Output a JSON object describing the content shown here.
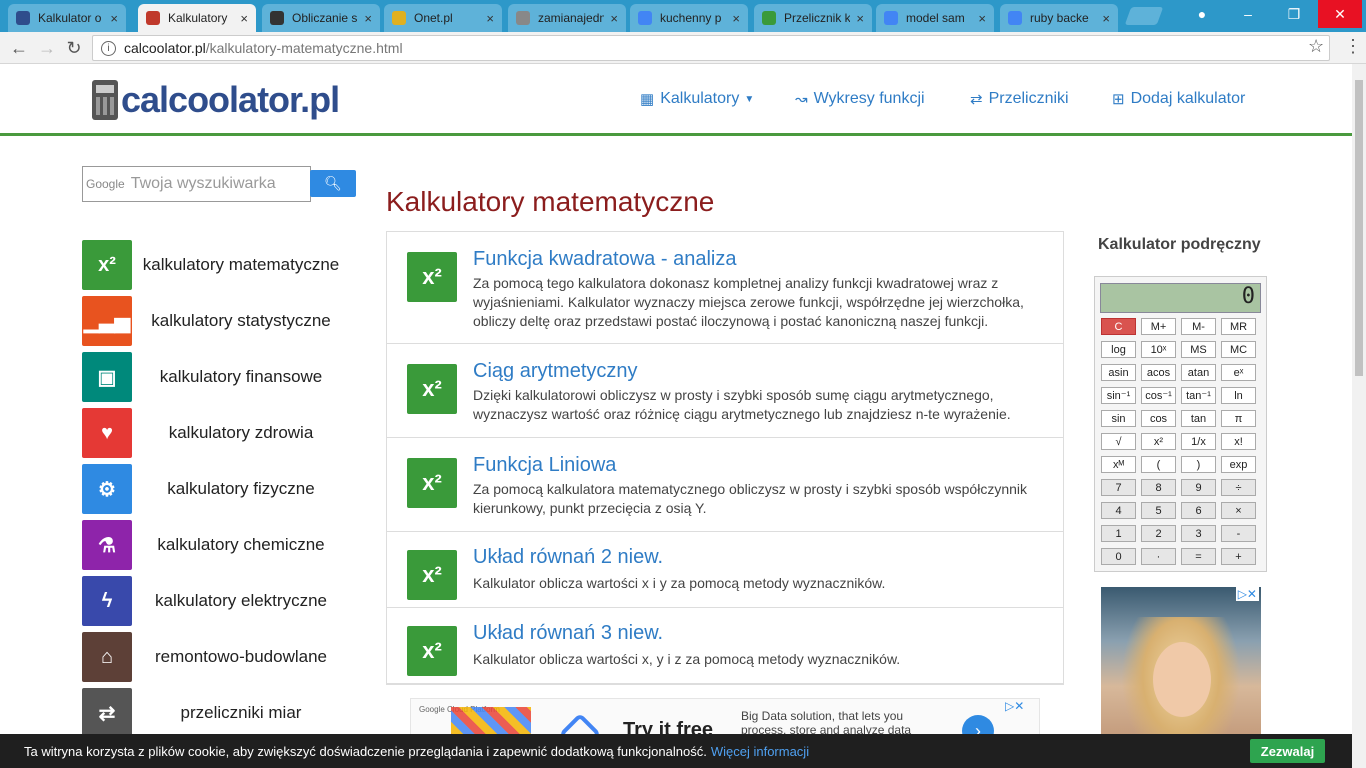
{
  "browser": {
    "tabs": [
      {
        "label": "Kalkulator o",
        "color": "#2f4d8c"
      },
      {
        "label": "Kalkulatory",
        "color": "#c0392b",
        "active": true
      },
      {
        "label": "Obliczanie s",
        "color": "#333"
      },
      {
        "label": "Onet.pl",
        "color": "#e0b020"
      },
      {
        "label": "zamianajedn",
        "color": "#888"
      },
      {
        "label": "kuchenny p",
        "color": "#4285f4"
      },
      {
        "label": "Przelicznik k",
        "color": "#3a9a3a"
      },
      {
        "label": "model sam",
        "color": "#4285f4"
      },
      {
        "label": "ruby backe",
        "color": "#4285f4"
      }
    ],
    "url_host": "calcoolator.pl",
    "url_path": "/kalkulatory-matematyczne.html"
  },
  "header": {
    "logo_text": "calcoolator.pl",
    "nav": {
      "kalkulatory": "Kalkulatory",
      "wykresy": "Wykresy funkcji",
      "przeliczniki": "Przeliczniki",
      "dodaj": "Dodaj kalkulator"
    }
  },
  "search": {
    "google_tag": "Google",
    "placeholder": "Twoja wyszukiwarka"
  },
  "categories": [
    {
      "label": "kalkulatory matematyczne",
      "icon": "x²",
      "color": "#3a9a3a"
    },
    {
      "label": "kalkulatory statystyczne",
      "icon": "bar-chart",
      "color": "#e8531f"
    },
    {
      "label": "kalkulatory finansowe",
      "icon": "money",
      "color": "#00897b"
    },
    {
      "label": "kalkulatory zdrowia",
      "icon": "heartbeat",
      "color": "#e53935"
    },
    {
      "label": "kalkulatory fizyczne",
      "icon": "gears",
      "color": "#2f8ae2"
    },
    {
      "label": "kalkulatory chemiczne",
      "icon": "flask",
      "color": "#8e24aa"
    },
    {
      "label": "kalkulatory elektryczne",
      "icon": "bolt",
      "color": "#3949ab"
    },
    {
      "label": "remontowo-budowlane",
      "icon": "home",
      "color": "#5d4037"
    },
    {
      "label": "przeliczniki miar",
      "icon": "shuffle",
      "color": "#555555"
    }
  ],
  "main": {
    "title": "Kalkulatory matematyczne",
    "items": [
      {
        "title": "Funkcja kwadratowa - analiza",
        "desc": "Za pomocą tego kalkulatora dokonasz kompletnej analizy funkcji kwadratowej wraz z wyjaśnieniami. Kalkulator wyznaczy miejsca zerowe funkcji, współrzędne jej wierzchołka, obliczy deltę oraz przedstawi postać iloczynową i postać kanoniczną naszej funkcji."
      },
      {
        "title": "Ciąg arytmetyczny",
        "desc": "Dzięki kalkulatorowi obliczysz w prosty i szybki sposób sumę ciągu arytmetycznego, wyznaczysz wartość oraz różnicę ciągu arytmetycznego lub znajdziesz n-te wyrażenie."
      },
      {
        "title": "Funkcja Liniowa",
        "desc": "Za pomocą kalkulatora matematycznego obliczysz w prosty i szybki sposób współczynnik kierunkowy, punkt przecięcia z osią Y."
      },
      {
        "title": "Układ równań 2 niew.",
        "desc": "Kalkulator oblicza wartości x i y za pomocą metody wyznaczników."
      },
      {
        "title": "Układ równań 3 niew.",
        "desc": "Kalkulator oblicza wartości x, y i z za pomocą metody wyznaczników."
      }
    ],
    "icon_text": "x²"
  },
  "ad": {
    "cta": "Try it free",
    "text": "Big Data solution, that lets you process, store and analyze data",
    "source": "Google Cloud Platform"
  },
  "calculator": {
    "title": "Kalkulator podręczny",
    "display": "0",
    "keys": [
      [
        "C",
        "M+",
        "M-",
        "MR"
      ],
      [
        "log",
        "10ˣ",
        "MS",
        "MC"
      ],
      [
        "asin",
        "acos",
        "atan",
        "eˣ"
      ],
      [
        "sin⁻¹",
        "cos⁻¹",
        "tan⁻¹",
        "ln"
      ],
      [
        "sin",
        "cos",
        "tan",
        "π"
      ],
      [
        "√",
        "x²",
        "1/x",
        "x!"
      ],
      [
        "xᴹ",
        "(",
        ")",
        "exp"
      ],
      [
        "7",
        "8",
        "9",
        "÷"
      ],
      [
        "4",
        "5",
        "6",
        "×"
      ],
      [
        "1",
        "2",
        "3",
        "-"
      ],
      [
        "0",
        "·",
        "=",
        "+"
      ]
    ]
  },
  "cookie": {
    "text": "Ta witryna korzysta z plików cookie, aby zwiększyć doświadczenie przeglądania i zapewnić dodatkową funkcjonalność.",
    "link": "Więcej informacji",
    "button": "Zezwalaj"
  }
}
